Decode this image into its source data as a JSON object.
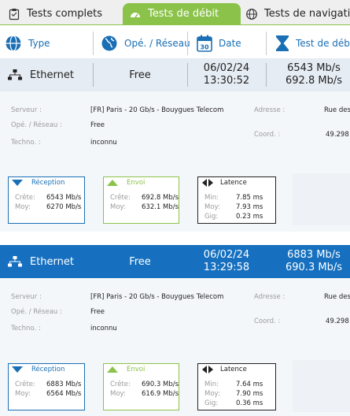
{
  "tabs": [
    {
      "label": "Tests complets"
    },
    {
      "label": "Tests de débit"
    },
    {
      "label": "Tests de navigation"
    }
  ],
  "columns": {
    "type": "Type",
    "operator": "Opé. / Réseau",
    "date": "Date",
    "speed": "Test de débit",
    "calendar_day": "30"
  },
  "results": [
    {
      "type": "Ethernet",
      "operator": "Free",
      "date": "06/02/24",
      "time": "13:30:52",
      "download": "6543 Mb/s",
      "upload": "692.8 Mb/s",
      "selected": false,
      "details": {
        "server_label": "Serveur :",
        "server": "[FR] Paris - 20 Gb/s - Bouygues Telecom",
        "operator_label": "Opé. / Réseau :",
        "operator": "Free",
        "techno_label": "Techno. :",
        "techno": "inconnu",
        "address_label": "Adresse :",
        "address": "Rue des",
        "coord_label": "Coord. :",
        "coord": "49.298"
      },
      "reception": {
        "title": "Réception",
        "peak_label": "Crête:",
        "peak": "6543 Mb/s",
        "avg_label": "Moy:",
        "avg": "6270 Mb/s"
      },
      "envoi": {
        "title": "Envoi",
        "peak_label": "Crête:",
        "peak": "692.8 Mb/s",
        "avg_label": "Moy:",
        "avg": "632.1 Mb/s"
      },
      "latency": {
        "title": "Latence",
        "min_label": "Min:",
        "min": "7.85 ms",
        "avg_label": "Moy:",
        "avg": "7.93 ms",
        "jitter_label": "Gig:",
        "jitter": "0.23 ms"
      }
    },
    {
      "type": "Ethernet",
      "operator": "Free",
      "date": "06/02/24",
      "time": "13:29:58",
      "download": "6883 Mb/s",
      "upload": "690.3 Mb/s",
      "selected": true,
      "details": {
        "server_label": "Serveur :",
        "server": "[FR] Paris - 20 Gb/s - Bouygues Telecom",
        "operator_label": "Opé. / Réseau :",
        "operator": "Free",
        "techno_label": "Techno. :",
        "techno": "inconnu",
        "address_label": "Adresse :",
        "address": "Rue des",
        "coord_label": "Coord. :",
        "coord": "49.298"
      },
      "reception": {
        "title": "Réception",
        "peak_label": "Crête:",
        "peak": "6883 Mb/s",
        "avg_label": "Moy:",
        "avg": "6564 Mb/s"
      },
      "envoi": {
        "title": "Envoi",
        "peak_label": "Crête:",
        "peak": "690.3 Mb/s",
        "avg_label": "Moy:",
        "avg": "616.9 Mb/s"
      },
      "latency": {
        "title": "Latence",
        "min_label": "Min:",
        "min": "7.64 ms",
        "avg_label": "Moy:",
        "avg": "7.90 ms",
        "jitter_label": "Gig:",
        "jitter": "0.36 ms"
      }
    }
  ],
  "colors": {
    "accent_green": "#8bc34a",
    "accent_blue": "#1a6fb5",
    "selected_row": "#1670bf"
  }
}
